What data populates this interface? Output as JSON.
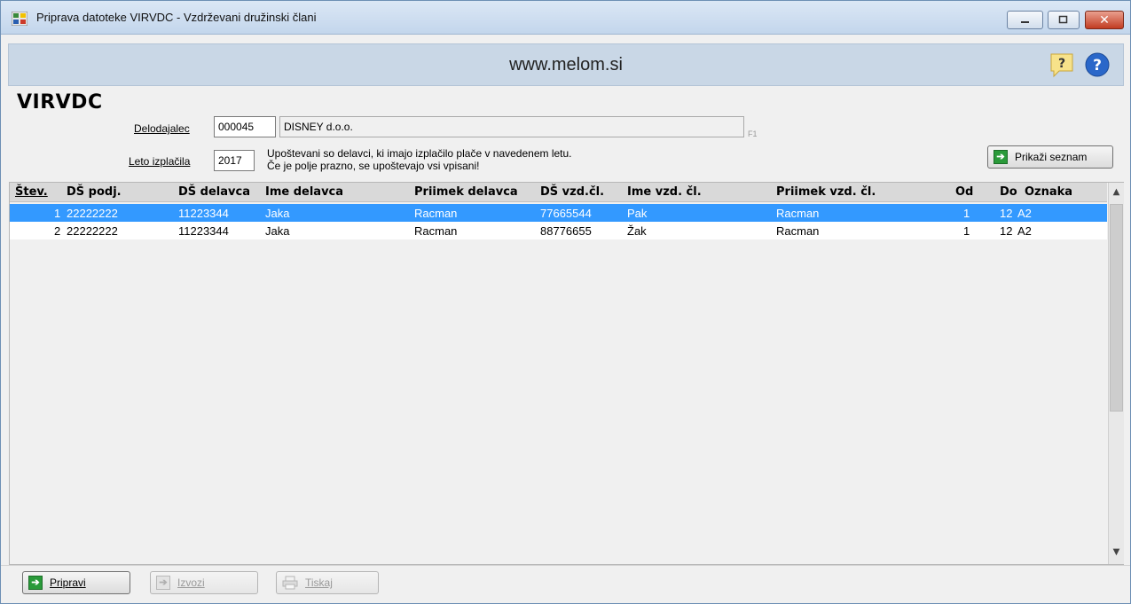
{
  "window": {
    "title": "Priprava datoteke VIRVDC  - Vzdrževani družinski člani"
  },
  "banner": {
    "title": "www.melom.si"
  },
  "app": {
    "heading": "VIRVDC"
  },
  "form": {
    "employer_label": "Delodajalec",
    "employer_code": "000045",
    "employer_name": "DISNEY d.o.o.",
    "employer_hint": "F1",
    "year_label": "Leto izplačila",
    "year_value": "2017",
    "note_line1": "Upoštevani so delavci, ki imajo izplačilo plače v navedenem letu.",
    "note_line2": "Če je polje prazno, se upoštevajo vsi vpisani!",
    "show_list_label": "Prikaži seznam"
  },
  "table": {
    "columns": [
      "Štev.",
      "DŠ podj.",
      "DŠ delavca",
      "Ime delavca",
      "Priimek delavca",
      "DŠ vzd.čl.",
      "Ime vzd. čl.",
      "Priimek vzd. čl.",
      "Od",
      "Do",
      "Oznaka"
    ],
    "rows": [
      {
        "stev": "1",
        "ds_podj": "22222222",
        "ds_delavca": "11223344",
        "ime": "Jaka",
        "priimek": "Racman",
        "ds_vzd": "77665544",
        "ime_vzd": "Pak",
        "priimek_vzd": "Racman",
        "od": "1",
        "do": "12",
        "oznaka": "A2"
      },
      {
        "stev": "2",
        "ds_podj": "22222222",
        "ds_delavca": "11223344",
        "ime": "Jaka",
        "priimek": "Racman",
        "ds_vzd": "88776655",
        "ime_vzd": "Žak",
        "priimek_vzd": "Racman",
        "od": "1",
        "do": "12",
        "oznaka": "A2"
      }
    ]
  },
  "footer": {
    "prepare_label": "Pripravi",
    "export_label": "Izvozi",
    "print_label": "Tiskaj"
  },
  "colors": {
    "selection": "#3399ff",
    "banner": "#c9d7e6"
  }
}
